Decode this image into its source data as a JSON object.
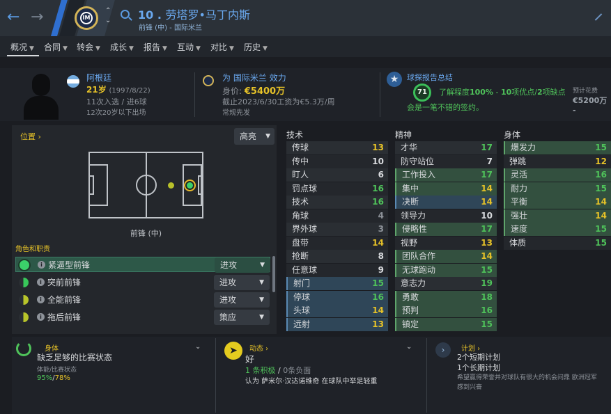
{
  "header": {
    "number": "10 .",
    "name": "劳塔罗•马丁内斯",
    "subtitle": "前锋 (中) - 国际米兰"
  },
  "nav": [
    "概况",
    "合同",
    "转会",
    "成长",
    "报告",
    "互动",
    "对比",
    "历史"
  ],
  "summary": {
    "nation": "阿根廷",
    "age": "21岁",
    "birth": "(1997/8/22)",
    "caps": "11次入选 / 进6球",
    "youth": "12次20岁以下出场",
    "club_prefix": "为",
    "club": "国际米兰",
    "club_suffix": "效力",
    "value_label": "身价:",
    "value": "€5400万",
    "contract": "截止2023/6/30工资为€5.3万/周",
    "squad_status": "常规先发",
    "scout_title": "球探报告总结",
    "scout_score": "71",
    "scout_pre": "了解程度",
    "scout_pct": "100%",
    "scout_mid": " - ",
    "scout_pros": "10",
    "scout_mid2": "项优点/",
    "scout_cons": "2",
    "scout_post": "项缺点",
    "scout_verdict": "会是一笔不错的签约。",
    "fee_label": "预计花费",
    "fee": "€5200万 -"
  },
  "position": {
    "title": "位置",
    "highlight": "高亮",
    "label": "前锋 (中)"
  },
  "roles": {
    "title": "角色和职责",
    "items": [
      {
        "name": "紧逼型前锋",
        "duty": "进攻"
      },
      {
        "name": "突前前锋",
        "duty": "进攻"
      },
      {
        "name": "全能前锋",
        "duty": "进攻"
      },
      {
        "name": "拖后前锋",
        "duty": "策应"
      }
    ]
  },
  "attributes": {
    "tech_title": "技术",
    "mental_title": "精神",
    "phys_title": "身体",
    "technical": [
      [
        "传球",
        "13"
      ],
      [
        "传中",
        "10"
      ],
      [
        "盯人",
        "6"
      ],
      [
        "罚点球",
        "16"
      ],
      [
        "技术",
        "16"
      ],
      [
        "角球",
        "4"
      ],
      [
        "界外球",
        "3"
      ],
      [
        "盘带",
        "14"
      ],
      [
        "抢断",
        "8"
      ],
      [
        "任意球",
        "9"
      ],
      [
        "射门",
        "15"
      ],
      [
        "停球",
        "16"
      ],
      [
        "头球",
        "14"
      ],
      [
        "远射",
        "13"
      ]
    ],
    "mental": [
      [
        "才华",
        "17"
      ],
      [
        "防守站位",
        "7"
      ],
      [
        "工作投入",
        "17"
      ],
      [
        "集中",
        "14"
      ],
      [
        "决断",
        "14"
      ],
      [
        "领导力",
        "10"
      ],
      [
        "侵略性",
        "17"
      ],
      [
        "视野",
        "13"
      ],
      [
        "团队合作",
        "14"
      ],
      [
        "无球跑动",
        "15"
      ],
      [
        "意志力",
        "19"
      ],
      [
        "勇敢",
        "18"
      ],
      [
        "预判",
        "16"
      ],
      [
        "镇定",
        "15"
      ]
    ],
    "physical": [
      [
        "爆发力",
        "15"
      ],
      [
        "弹跳",
        "12"
      ],
      [
        "灵活",
        "16"
      ],
      [
        "耐力",
        "15"
      ],
      [
        "平衡",
        "14"
      ],
      [
        "强壮",
        "14"
      ],
      [
        "速度",
        "15"
      ],
      [
        "体质",
        "15"
      ]
    ]
  },
  "bottom": {
    "body_title": "身体",
    "body_status": "缺乏足够的比赛状态",
    "body_sub": "体能/比赛状态",
    "body_fit": "95%",
    "body_sep": "/",
    "body_match": "78%",
    "dyn_title": "动态",
    "dyn_value": "好",
    "dyn_pos": "1 条积极",
    "dyn_sep": " / ",
    "dyn_neg": "0条负面",
    "dyn_note": "认为 萨米尔·汉达诺维奇 在球队中举足轻重",
    "plan_title": "计划",
    "plan_short": "2个短期计划",
    "plan_long": "1个长期计划",
    "plan_note1": "希望赢得荣誉并对球队有很大的机会问鼎 欧洲冠军",
    "plan_note2": "感到兴奋"
  },
  "colors": {
    "accent": "#4a8fd6",
    "yellow": "#e6c228",
    "green": "#4fc25a",
    "header_bg": "#2b3138"
  }
}
